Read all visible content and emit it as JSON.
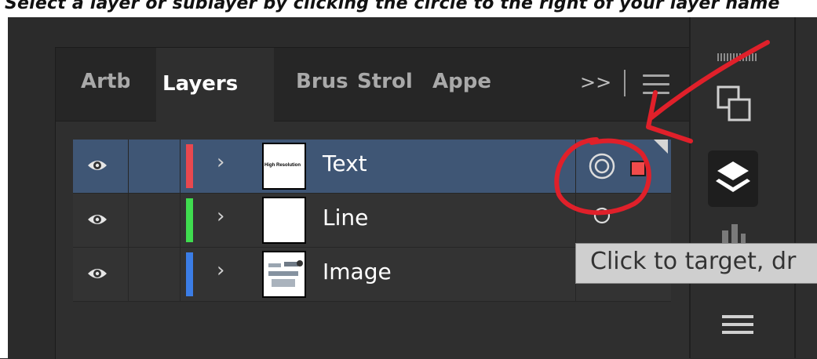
{
  "caption": "Select a layer or sublayer by clicking the circle to the right of your layer name",
  "panel": {
    "tabs": [
      "Artb",
      "Layers",
      "Brus",
      "Strol",
      "Appe"
    ],
    "active_tab": "Layers",
    "overflow_label": ">>"
  },
  "layers": [
    {
      "name": "Text",
      "color": "#e8484f",
      "selected": true,
      "thumb_text": "High Resolution"
    },
    {
      "name": "Line",
      "color": "#3fdc4f",
      "selected": false
    },
    {
      "name": "Image",
      "color": "#3b7de6",
      "selected": false
    }
  ],
  "tooltip": "Click to target, dr",
  "annotation_color": "#e0202a"
}
